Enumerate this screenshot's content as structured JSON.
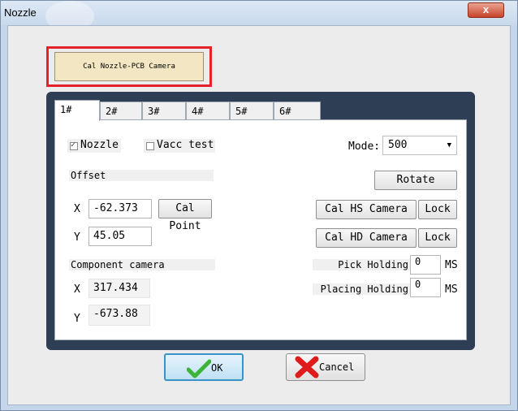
{
  "window": {
    "title": "Nozzle",
    "close_glyph": "x"
  },
  "calibrate": {
    "label": "Cal Nozzle-PCB Camera"
  },
  "tabs": [
    "1#",
    "2#",
    "3#",
    "4#",
    "5#",
    "6#"
  ],
  "active_tab": "1#",
  "panel": {
    "nozzle_label": "Nozzle",
    "nozzle_checked": true,
    "vacc_label": "Vacc test",
    "vacc_checked": false,
    "mode_label": "Mode:",
    "mode_value": "500",
    "offset_label": "Offset",
    "offset_x_label": "X",
    "offset_x_value": "-62.373",
    "offset_y_label": "Y",
    "offset_y_value": "45.05",
    "cal_point_label": "Cal Point",
    "rotate_label": "Rotate",
    "cal_hs_label": "Cal HS Camera",
    "cal_hd_label": "Cal HD Camera",
    "lock_label": "Lock",
    "component_label": "Component camera",
    "comp_x_label": "X",
    "comp_x_value": "317.434",
    "comp_y_label": "Y",
    "comp_y_value": "-673.88",
    "pick_label": "Pick Holding",
    "pick_value": "0",
    "placing_label": "Placing Holding",
    "placing_value": "0",
    "unit": "MS"
  },
  "footer": {
    "ok_label": "OK",
    "cancel_label": "Cancel"
  },
  "colors": {
    "highlight": "#e2222c",
    "cal_button": "#f2e7c2",
    "tab_frame": "#2d3e55",
    "ok_check": "#3cb43c",
    "cancel_x": "#e01b1b"
  }
}
